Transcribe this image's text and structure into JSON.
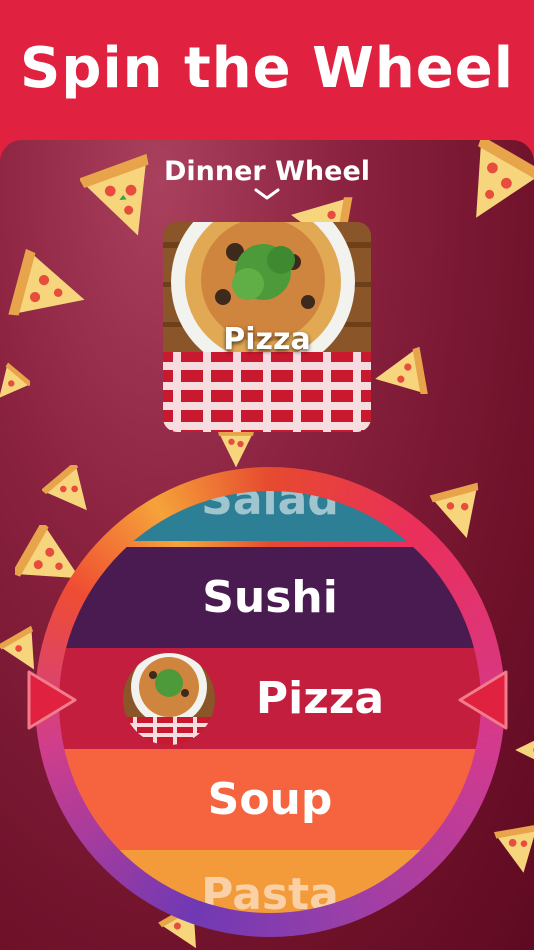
{
  "header": {
    "title": "Spin the Wheel"
  },
  "selector": {
    "title": "Dinner Wheel",
    "icon": "chevron-down-icon"
  },
  "preview": {
    "label": "Pizza"
  },
  "wheel": {
    "bands": [
      {
        "label": "Salad",
        "color": "#2d7f95",
        "dim": true
      },
      {
        "label": "Sushi",
        "color": "#4a1b50"
      },
      {
        "label": "Pizza",
        "color": "#c41e3f",
        "selected": true
      },
      {
        "label": "Soup",
        "color": "#f5633f"
      },
      {
        "label": "Pasta",
        "color": "#f39a3a",
        "dim": true
      }
    ]
  },
  "colors": {
    "banner": "#e0213f",
    "background": "#7a1630",
    "pointer": "#e0213f"
  }
}
